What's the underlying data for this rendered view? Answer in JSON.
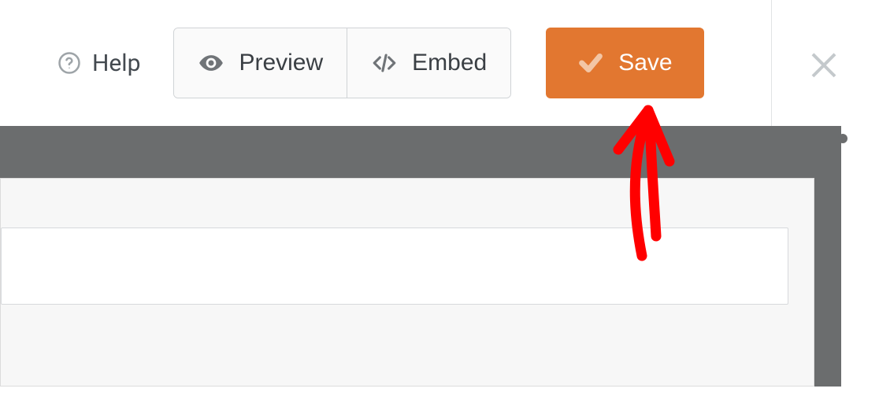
{
  "toolbar": {
    "help_label": "Help",
    "preview_label": "Preview",
    "embed_label": "Embed",
    "save_label": "Save"
  },
  "colors": {
    "accent": "#e27730",
    "grey_frame": "#6b6d6e",
    "annotation_red": "#ff0000"
  }
}
